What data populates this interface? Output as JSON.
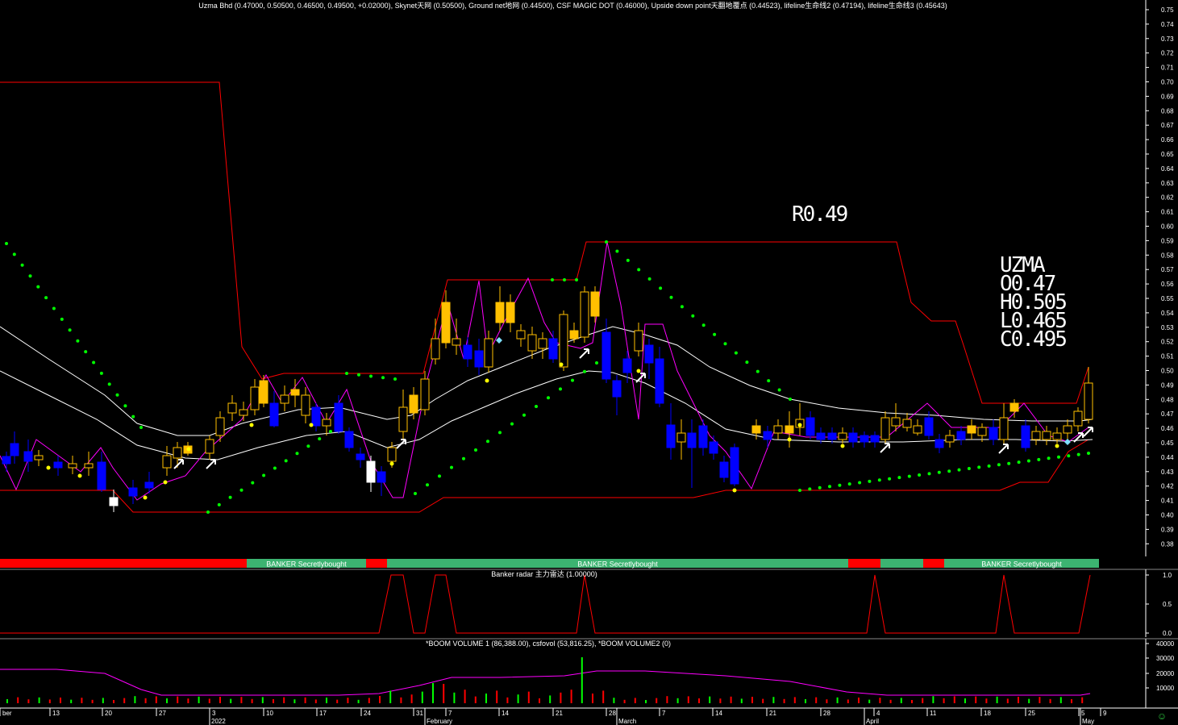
{
  "header_main": "Uzma Bhd (0.47000, 0.50500, 0.46500, 0.49500, +0.02000), Skynet天网 (0.50500), Ground net地网 (0.44500), CSF MAGIC DOT (0.46000), Upside down point天翻地覆点 (0.44523), lifeline生命线2 (0.47194), lifeline生命线3 (0.45643)",
  "header_radar": "Banker radar 主力雷达 (1.00000)",
  "header_volume": "*BOOM VOLUME 1 (86,388.00), csfovol (53,816.25), *BOOM VOLUME2 (0)",
  "r_label": "R0.49",
  "ohlc": {
    "ticker": "UZMA",
    "open": "O0.47",
    "high": "H0.505",
    "low": "L0.465",
    "close": "C0.495"
  },
  "banker_label": "BANKER Secretlybought",
  "smiley": "☺",
  "colors": {
    "up": "#ffc000",
    "down": "#0000ff",
    "bg": "#000000",
    "skynet": "#ff0000",
    "lifeline": "#ffffff",
    "magenta": "#ff00ff",
    "dots": "#00ff00",
    "banker_green": "#3cb371",
    "banker_red": "#ff0000"
  },
  "chart_data": {
    "type": "candlestick",
    "price_axis": {
      "min": 0.38,
      "max": 0.75,
      "ticks": [
        "0.75",
        "0.74",
        "0.73",
        "0.72",
        "0.71",
        "0.70",
        "0.69",
        "0.68",
        "0.67",
        "0.66",
        "0.65",
        "0.64",
        "0.63",
        "0.62",
        "0.61",
        "0.60",
        "0.59",
        "0.58",
        "0.57",
        "0.56",
        "0.55",
        "0.54",
        "0.53",
        "0.52",
        "0.51",
        "0.50",
        "0.49",
        "0.48",
        "0.47",
        "0.46",
        "0.45",
        "0.44",
        "0.43",
        "0.42",
        "0.41",
        "0.40",
        "0.39",
        "0.38"
      ]
    },
    "radar_axis": {
      "ticks": [
        "1.0",
        "0.5",
        "0.0"
      ]
    },
    "volume_axis": {
      "ticks": [
        "40000",
        "30000",
        "20000",
        "10000"
      ]
    },
    "date_labels": [
      "ber",
      "13",
      "20",
      "27",
      "3",
      "10",
      "17",
      "24",
      "31",
      "7",
      "14",
      "21",
      "28",
      "7",
      "14",
      "21",
      "28",
      "4",
      "11",
      "18",
      "25",
      "5",
      "9"
    ],
    "month_labels": [
      "2022",
      "February",
      "March",
      "April",
      "May"
    ],
    "last_candle": {
      "open": 0.47,
      "high": 0.505,
      "low": 0.465,
      "close": 0.495
    },
    "indicators": {
      "Skynet": 0.505,
      "Ground net": 0.445,
      "CSF MAGIC DOT": 0.46,
      "Upside down point": 0.44523,
      "lifeline2": 0.47194,
      "lifeline3": 0.45643
    },
    "banker_radar_last": 1.0,
    "boom_volume_1": 86388.0,
    "csfovol": 53816.25,
    "boom_volume_2": 0
  }
}
